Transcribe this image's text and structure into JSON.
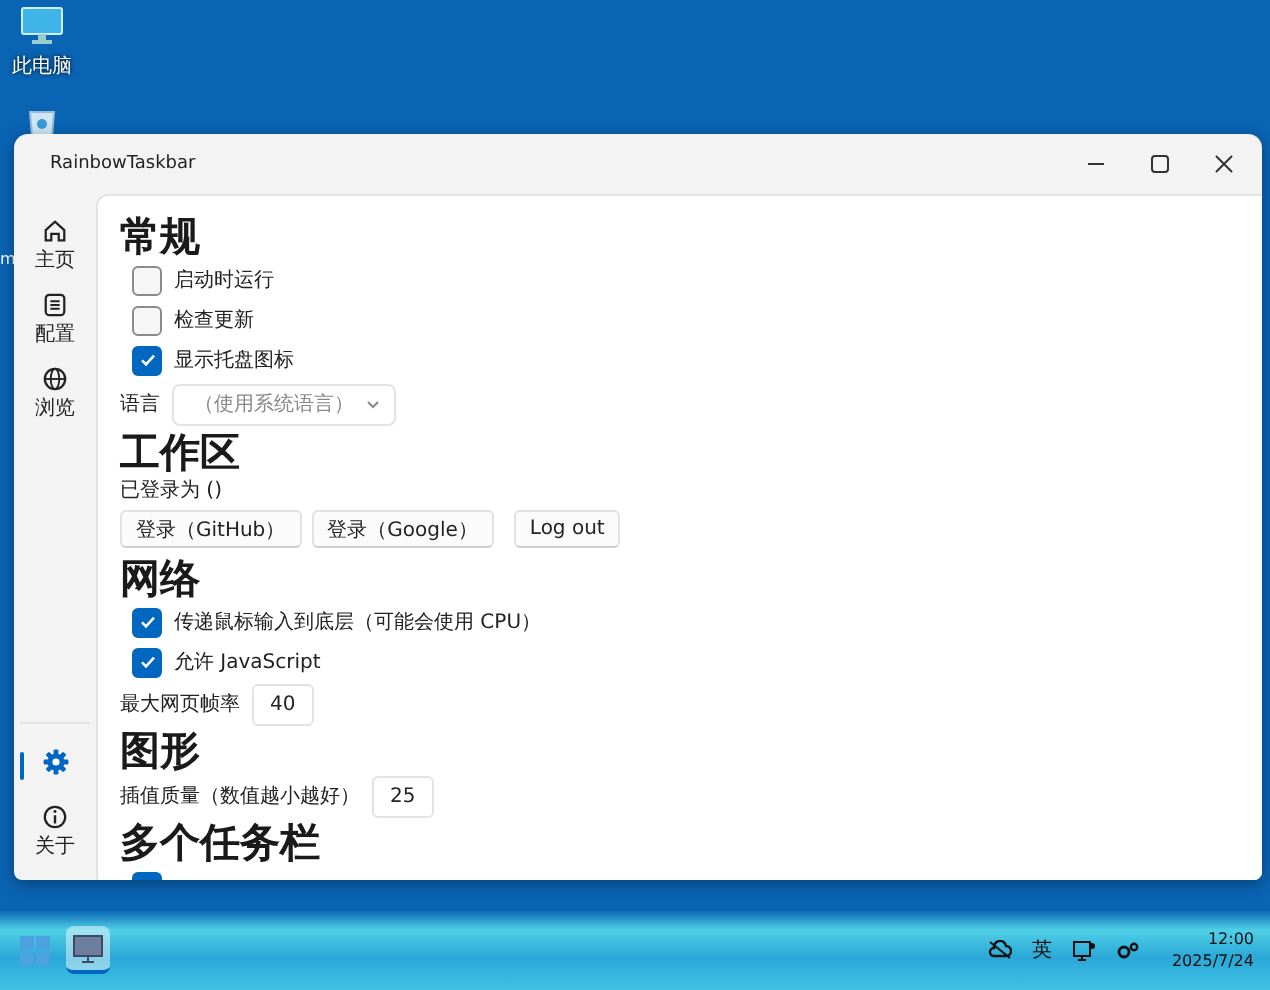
{
  "desktop": {
    "icons": [
      {
        "label": "此电脑"
      }
    ],
    "label_fragment": "m"
  },
  "window": {
    "title": "RainbowTaskbar"
  },
  "sidebar": {
    "top_items": [
      {
        "label": "主页",
        "selected": false
      },
      {
        "label": "配置",
        "selected": false
      },
      {
        "label": "浏览",
        "selected": false
      }
    ],
    "bottom_items": [
      {
        "selected": true
      },
      {
        "label": "关于",
        "selected": false
      }
    ]
  },
  "sections": [
    {
      "heading": "常规",
      "items": [
        {
          "kind": "checkbox",
          "label": "启动时运行",
          "checked": false
        },
        {
          "kind": "checkbox",
          "label": "检查更新",
          "checked": false
        },
        {
          "kind": "checkbox",
          "label": "显示托盘图标",
          "checked": true
        },
        {
          "kind": "select",
          "label": "语言",
          "placeholder": "（使用系统语言）"
        }
      ]
    },
    {
      "heading": "工作区",
      "items": [
        {
          "kind": "text",
          "text": "已登录为 ()"
        },
        {
          "kind": "buttons",
          "buttons": [
            "登录（GitHub）",
            "登录（Google）",
            "Log out"
          ]
        }
      ]
    },
    {
      "heading": "网络",
      "items": [
        {
          "kind": "checkbox",
          "label": "传递鼠标输入到底层（可能会使用 CPU）",
          "checked": true
        },
        {
          "kind": "checkbox",
          "label": "允许 JavaScript",
          "checked": true
        },
        {
          "kind": "number",
          "label": "最大网页帧率",
          "value": "40"
        }
      ]
    },
    {
      "heading": "图形",
      "items": [
        {
          "kind": "number",
          "label": "插值质量（数值越小越好）",
          "value": "25"
        }
      ]
    },
    {
      "heading": "多个任务栏",
      "items": [
        {
          "kind": "checkbox",
          "checked": true
        }
      ]
    }
  ],
  "taskbar": {
    "apps": [
      {
        "selected": true
      }
    ],
    "tray": {
      "language": "英",
      "time": "12:00",
      "date": "2025/7/24"
    }
  }
}
